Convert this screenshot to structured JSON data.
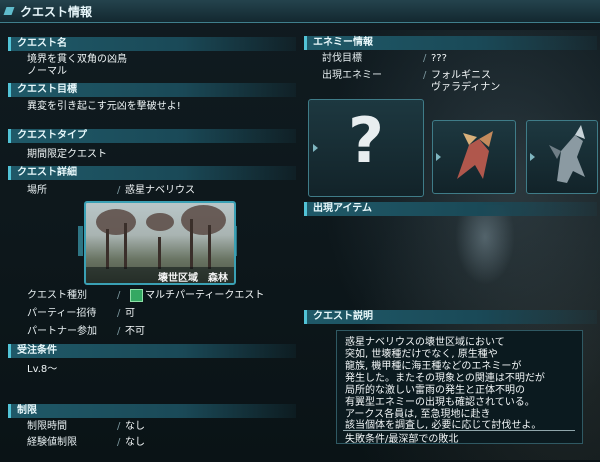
{
  "window": {
    "title": "クエスト情報"
  },
  "quest_name": {
    "header": "クエスト名",
    "name": "境界を貫く双角の凶鳥",
    "difficulty": "ノーマル"
  },
  "quest_objective": {
    "header": "クエスト目標",
    "text": "異変を引き起こす元凶を撃破せよ!"
  },
  "quest_type": {
    "header": "クエストタイプ",
    "text": "期間限定クエスト"
  },
  "quest_detail": {
    "header": "クエスト詳細",
    "location_label": "場所",
    "location_value": "惑星ナベリウス",
    "map_caption": "壊世区域　森林",
    "kind_label": "クエスト種別",
    "kind_value": "マルチパーティークエスト",
    "party_label": "パーティー招待",
    "party_value": "可",
    "partner_label": "パートナー参加",
    "partner_value": "不可"
  },
  "order_conditions": {
    "header": "受注条件",
    "level": "Lv.8～"
  },
  "limits": {
    "header": "制限",
    "time_label": "制限時間",
    "time_value": "なし",
    "exp_label": "経験値制限",
    "exp_value": "なし"
  },
  "enemy_info": {
    "header": "エネミー情報",
    "target_label": "討伐目標",
    "target_value": "???",
    "appear_label": "出現エネミー",
    "appear_values": [
      "フォルギニス",
      "ヴァラディナン"
    ]
  },
  "items": {
    "header": "出現アイテム"
  },
  "description": {
    "header": "クエスト説明",
    "lines": [
      "惑星ナベリウスの壊世区域において",
      "突如, 世壊種だけでなく, 原生種や",
      "龍族, 機甲種に海王種などのエネミーが",
      "発生した。またその現象との関連は不明だが",
      "局所的な激しい雷雨の発生と正体不明の",
      "有翼型エネミーの出現も確認されている。",
      "アークス各員は, 至急現地に赴き",
      "該当個体を調査し, 必要に応じて討伐せよ。"
    ],
    "failure": "失敗条件/最深部での敗北"
  },
  "colors": {
    "accent": "#52c3d6",
    "header_bg": "#1f5968"
  }
}
